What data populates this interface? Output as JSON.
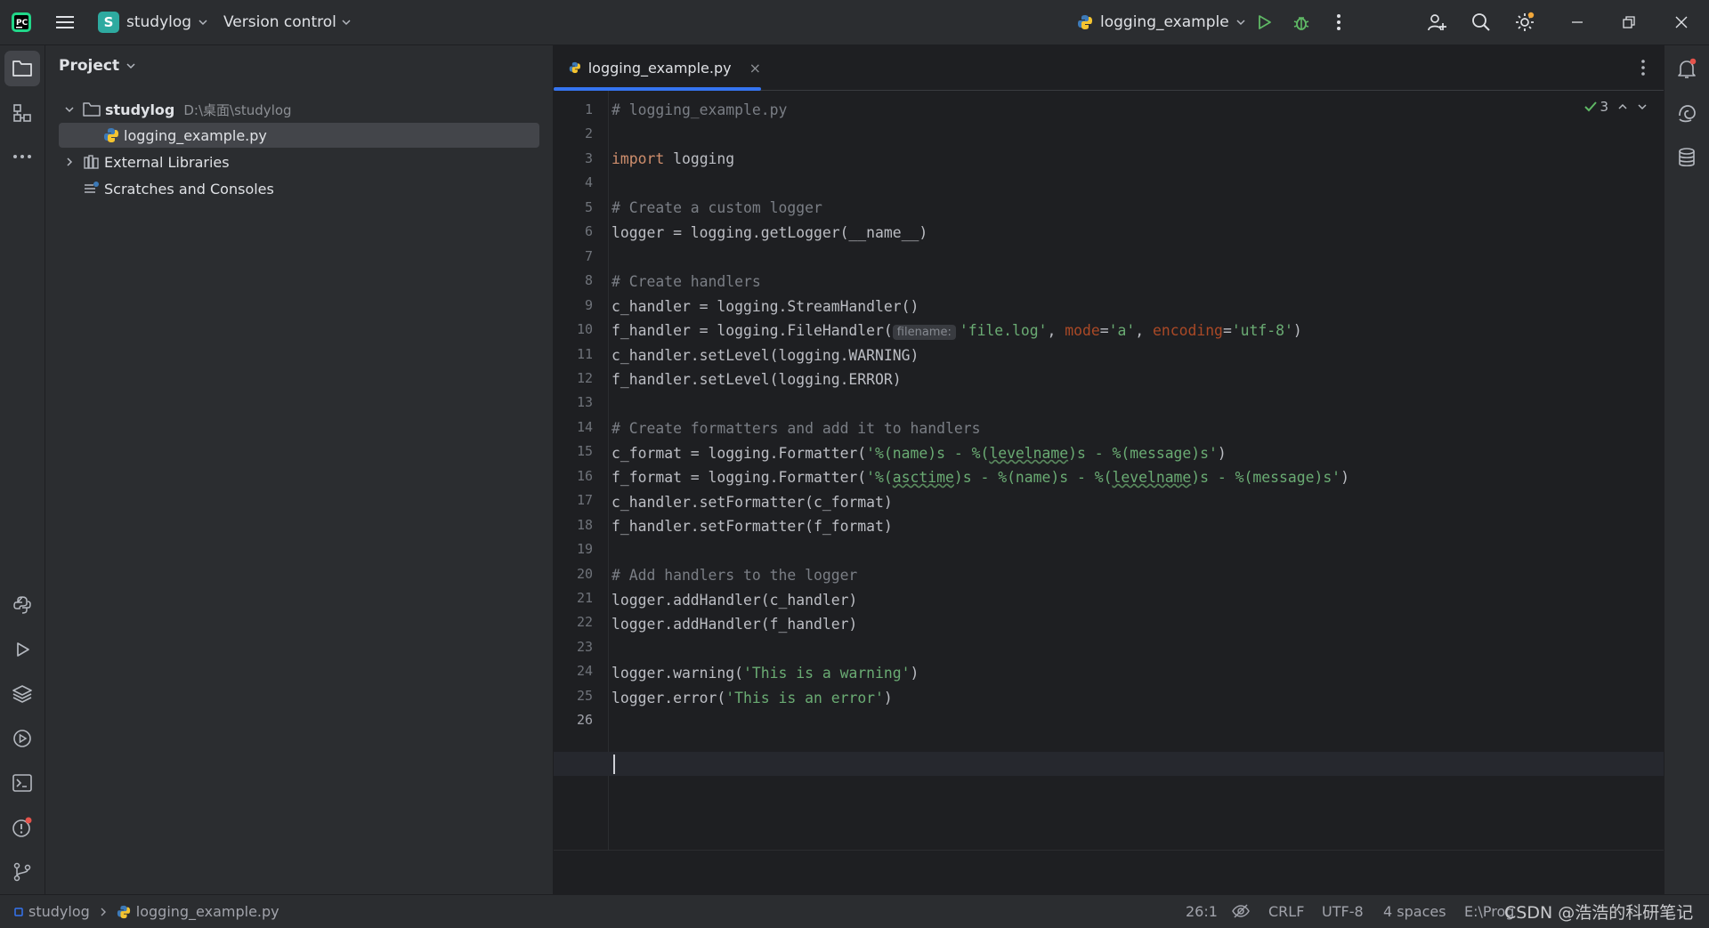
{
  "titlebar": {
    "project_badge": "S",
    "project_name": "studylog",
    "version_control": "Version control",
    "run_config": "logging_example"
  },
  "project_panel": {
    "title": "Project",
    "tree": {
      "root_name": "studylog",
      "root_path": "D:\\桌面\\studylog",
      "file": "logging_example.py",
      "external_libraries": "External Libraries",
      "scratches": "Scratches and Consoles"
    }
  },
  "editor": {
    "tab_label": "logging_example.py",
    "tab_close": "×",
    "inspection_count": "3",
    "current_line": "26",
    "lines": [
      {
        "n": "1"
      },
      {
        "n": "2"
      },
      {
        "n": "3"
      },
      {
        "n": "4"
      },
      {
        "n": "5"
      },
      {
        "n": "6"
      },
      {
        "n": "7"
      },
      {
        "n": "8"
      },
      {
        "n": "9"
      },
      {
        "n": "10"
      },
      {
        "n": "11"
      },
      {
        "n": "12"
      },
      {
        "n": "13"
      },
      {
        "n": "14"
      },
      {
        "n": "15"
      },
      {
        "n": "16"
      },
      {
        "n": "17"
      },
      {
        "n": "18"
      },
      {
        "n": "19"
      },
      {
        "n": "20"
      },
      {
        "n": "21"
      },
      {
        "n": "22"
      },
      {
        "n": "23"
      },
      {
        "n": "24"
      },
      {
        "n": "25"
      },
      {
        "n": "26"
      }
    ],
    "code": {
      "l1": "# logging_example.py",
      "l3_kw": "import",
      "l3_rest": " logging",
      "l5": "# Create a custom logger",
      "l6": "logger = logging.getLogger(__name__)",
      "l8": "# Create handlers",
      "l9": "c_handler = logging.StreamHandler()",
      "l10_a": "f_handler = logging.FileHandler(",
      "l10_hint": "filename:",
      "l10_s1": "'file.log'",
      "l10_c1": ", ",
      "l10_p1": "mode",
      "l10_eq1": "=",
      "l10_s2": "'a'",
      "l10_c2": ", ",
      "l10_p2": "encoding",
      "l10_eq2": "=",
      "l10_s3": "'utf-8'",
      "l10_end": ")",
      "l11": "c_handler.setLevel(logging.WARNING)",
      "l12": "f_handler.setLevel(logging.ERROR)",
      "l14": "# Create formatters and add it to handlers",
      "l15_a": "c_format = logging.Formatter(",
      "l15_s1": "'%(name)s - %(",
      "l15_u1": "levelname",
      "l15_s2": ")s - %(message)s'",
      "l15_end": ")",
      "l16_a": "f_format = logging.Formatter(",
      "l16_s1": "'%(",
      "l16_u1": "asctime",
      "l16_s2": ")s - %(name)s - %(",
      "l16_u2": "levelname",
      "l16_s3": ")s - %(message)s'",
      "l16_end": ")",
      "l17": "c_handler.setFormatter(c_format)",
      "l18": "f_handler.setFormatter(f_format)",
      "l20": "# Add handlers to the logger",
      "l21": "logger.addHandler(c_handler)",
      "l22": "logger.addHandler(f_handler)",
      "l24_a": "logger.warning(",
      "l24_s": "'This is a warning'",
      "l24_end": ")",
      "l25_a": "logger.error(",
      "l25_s": "'This is an error'",
      "l25_end": ")"
    }
  },
  "statusbar": {
    "crumb_project": "studylog",
    "crumb_file": "logging_example.py",
    "position": "26:1",
    "line_sep": "CRLF",
    "encoding": "UTF-8",
    "indent": "4 spaces",
    "interpreter": "E:\\Prog",
    "watermark": "CSDN @浩浩的科研笔记"
  },
  "colors": {
    "accent": "#3574f0",
    "keyword": "#cf8e6d",
    "string": "#6aab73",
    "comment": "#7a7e85",
    "param": "#aa4926"
  }
}
